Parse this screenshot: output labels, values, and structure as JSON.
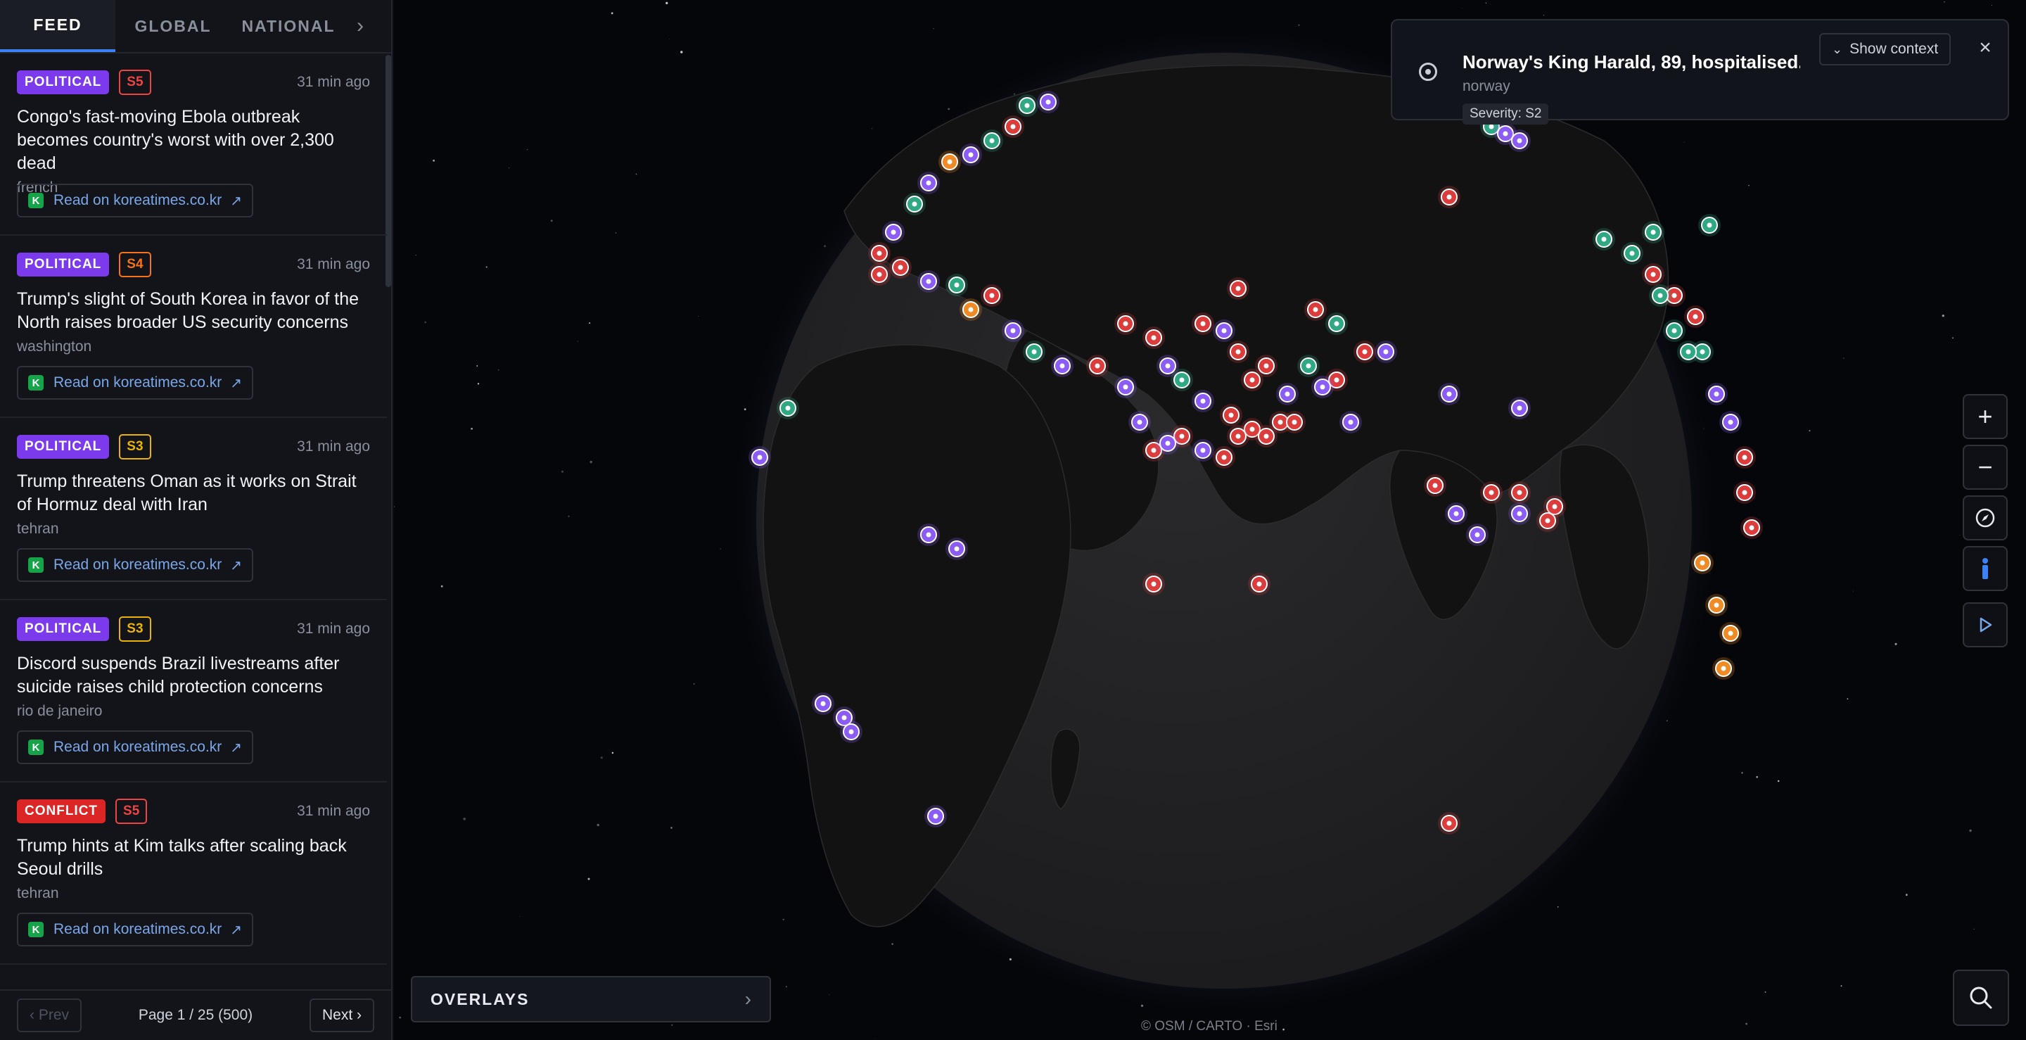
{
  "tabs": [
    {
      "label": "FEED",
      "active": true
    },
    {
      "label": "GLOBAL",
      "active": false
    },
    {
      "label": "NATIONAL",
      "active": false
    }
  ],
  "tabs_more_icon": "chevron-right-icon",
  "feed": [
    {
      "category": "POLITICAL",
      "severity": "S5",
      "time": "31 min ago",
      "headline": "Congo's fast-moving Ebola outbreak becomes country's worst with over 2,300 dead",
      "location": "french",
      "read": "Read on koreatimes.co.kr"
    },
    {
      "category": "POLITICAL",
      "severity": "S4",
      "time": "31 min ago",
      "headline": "Trump's slight of South Korea in favor of the North raises broader US security concerns",
      "location": "washington",
      "read": "Read on koreatimes.co.kr"
    },
    {
      "category": "POLITICAL",
      "severity": "S3",
      "time": "31 min ago",
      "headline": "Trump threatens Oman as it works on Strait of Hormuz deal with Iran",
      "location": "tehran",
      "read": "Read on koreatimes.co.kr"
    },
    {
      "category": "POLITICAL",
      "severity": "S3",
      "time": "31 min ago",
      "headline": "Discord suspends Brazil livestreams after suicide raises child protection concerns",
      "location": "rio de janeiro",
      "read": "Read on koreatimes.co.kr"
    },
    {
      "category": "CONFLICT",
      "severity": "S5",
      "time": "31 min ago",
      "headline": "Trump hints at Kim talks after scaling back Seoul drills",
      "location": "tehran",
      "read": "Read on koreatimes.co.kr"
    }
  ],
  "source_badge": "K",
  "pager": {
    "prev": "‹ Prev",
    "info": "Page 1 / 25 (500)",
    "next": "Next ›"
  },
  "notice": {
    "title": "Norway's King Harald, 89, hospitalised...",
    "location": "norway",
    "severity": "Severity: S2",
    "context_label": "Show context"
  },
  "overlays": {
    "label": "OVERLAYS"
  },
  "attribution": "© OSM / CARTO · Esri",
  "colors": {
    "accent": "#3b82f6",
    "political": "#7c3aed",
    "conflict": "#dc2626",
    "s5": "#ef4444",
    "s4": "#f97316",
    "s3": "#eab308",
    "marker_political": "#8b5cf6",
    "marker_conflict": "#dc3c3c",
    "marker_economic": "#2fa884",
    "marker_fire": "#f08a24"
  }
}
